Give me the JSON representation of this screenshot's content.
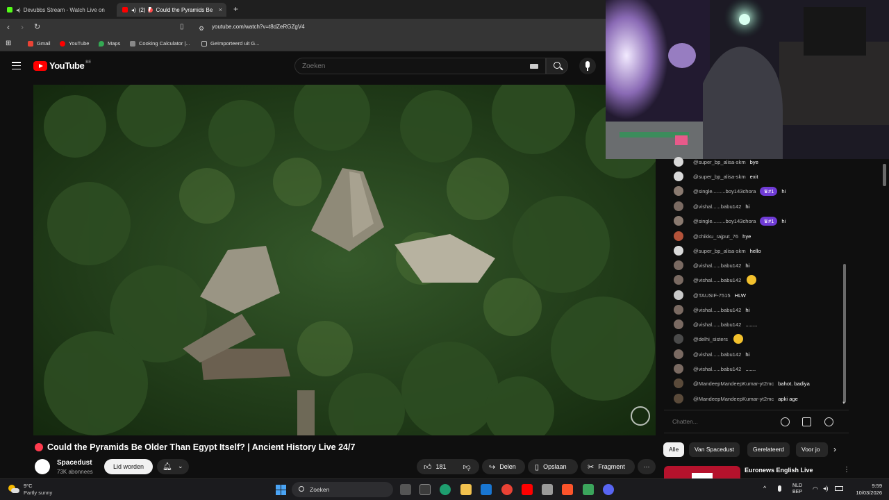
{
  "browser": {
    "tabs": [
      {
        "title": "Devubbs Stream - Watch Live on",
        "favicon_color": "#53fc18"
      },
      {
        "title": "Could the Pyramids Be",
        "audio_count": "(2)",
        "favicon_color": "#ff0000"
      }
    ],
    "new_tab": "+",
    "close_tab": "×",
    "url": "youtube.com/watch?v=t8dZeRGZgV4",
    "bookmarks": [
      {
        "label": "Gmail",
        "color": "#ea4335"
      },
      {
        "label": "YouTube",
        "color": "#ff0000"
      },
      {
        "label": "Maps",
        "color": "#34a853"
      },
      {
        "label": "Cooking Calculator |...",
        "color": "#888888"
      },
      {
        "label": "Geïmporteerd uit G...",
        "color": "#bbbbbb"
      }
    ]
  },
  "youtube": {
    "logo_text": "YouTube",
    "country_code": "BE",
    "search_placeholder": "Zoeken"
  },
  "video": {
    "title": "Could the Pyramids Be Older Than Egypt Itself? | Ancient History Live 24/7",
    "channel": "Spacedust",
    "subscribers": "73K abonnees",
    "join_label": "Lid worden",
    "likes": "181",
    "share_label": "Delen",
    "save_label": "Opslaan",
    "clip_label": "Fragment",
    "more_label": "···"
  },
  "chat": {
    "messages": [
      {
        "author": "@super_bp_alisa-skm",
        "text": "bye",
        "avatar": "#d9d9d9"
      },
      {
        "author": "@super_bp_alisa-skm",
        "text": "exit",
        "avatar": "#d9d9d9"
      },
      {
        "author": "@single.........boy143chora",
        "badge": "#1",
        "text": "hi",
        "avatar": "#8a7a70"
      },
      {
        "author": "@vishal......babu142",
        "text": "hi",
        "avatar": "#7a6a62"
      },
      {
        "author": "@single.........boy143chora",
        "badge": "#1",
        "text": "hi",
        "avatar": "#8a7a70"
      },
      {
        "author": "@chikku_rajput_76",
        "text": "hye",
        "avatar": "#b4533a"
      },
      {
        "author": "@super_bp_alisa-skm",
        "text": "hello",
        "avatar": "#d9d9d9"
      },
      {
        "author": "@vishal......babu142",
        "text": "hi",
        "avatar": "#7a6a62"
      },
      {
        "author": "@vishal......babu142",
        "text": "",
        "emoji": "thinking-emoji",
        "avatar": "#7a6a62"
      },
      {
        "author": "@TAUSIF-7515",
        "text": "HLW",
        "avatar": "#c9c9c9"
      },
      {
        "author": "@vishal......babu142",
        "text": "hi",
        "avatar": "#7a6a62"
      },
      {
        "author": "@vishal......babu142",
        "text": "........",
        "avatar": "#7a6a62"
      },
      {
        "author": "@delhi_sisters",
        "text": "",
        "emoji": "grinning-emoji",
        "avatar": "#4a4a4a"
      },
      {
        "author": "@vishal......babu142",
        "text": "hi",
        "avatar": "#7a6a62"
      },
      {
        "author": "@vishal......babu142",
        "text": ".......",
        "avatar": "#7a6a62"
      },
      {
        "author": "@MandeepMandeepKumar-yt2mc",
        "text": "bahot. badiya",
        "avatar": "#5a4a3a"
      },
      {
        "author": "@MandeepMandeepKumar-yt2mc",
        "text": "apki age",
        "avatar": "#5a4a3a"
      }
    ],
    "input_placeholder": "Chatten..."
  },
  "chips": [
    "Alle",
    "Van Spacedust",
    "Gerelateerd",
    "Voor jo"
  ],
  "recommendation": {
    "title": "Euronews English Live"
  },
  "taskbar": {
    "temperature": "9°C",
    "weather": "Partly sunny",
    "search": "Zoeken",
    "lang_line1": "NLD",
    "lang_line2": "BEP",
    "time": "9:59",
    "date": "10/03/2026"
  },
  "colors": {
    "accent": "#ff0000",
    "live": "#ff3b4e",
    "badge": "#6f3bd5"
  }
}
